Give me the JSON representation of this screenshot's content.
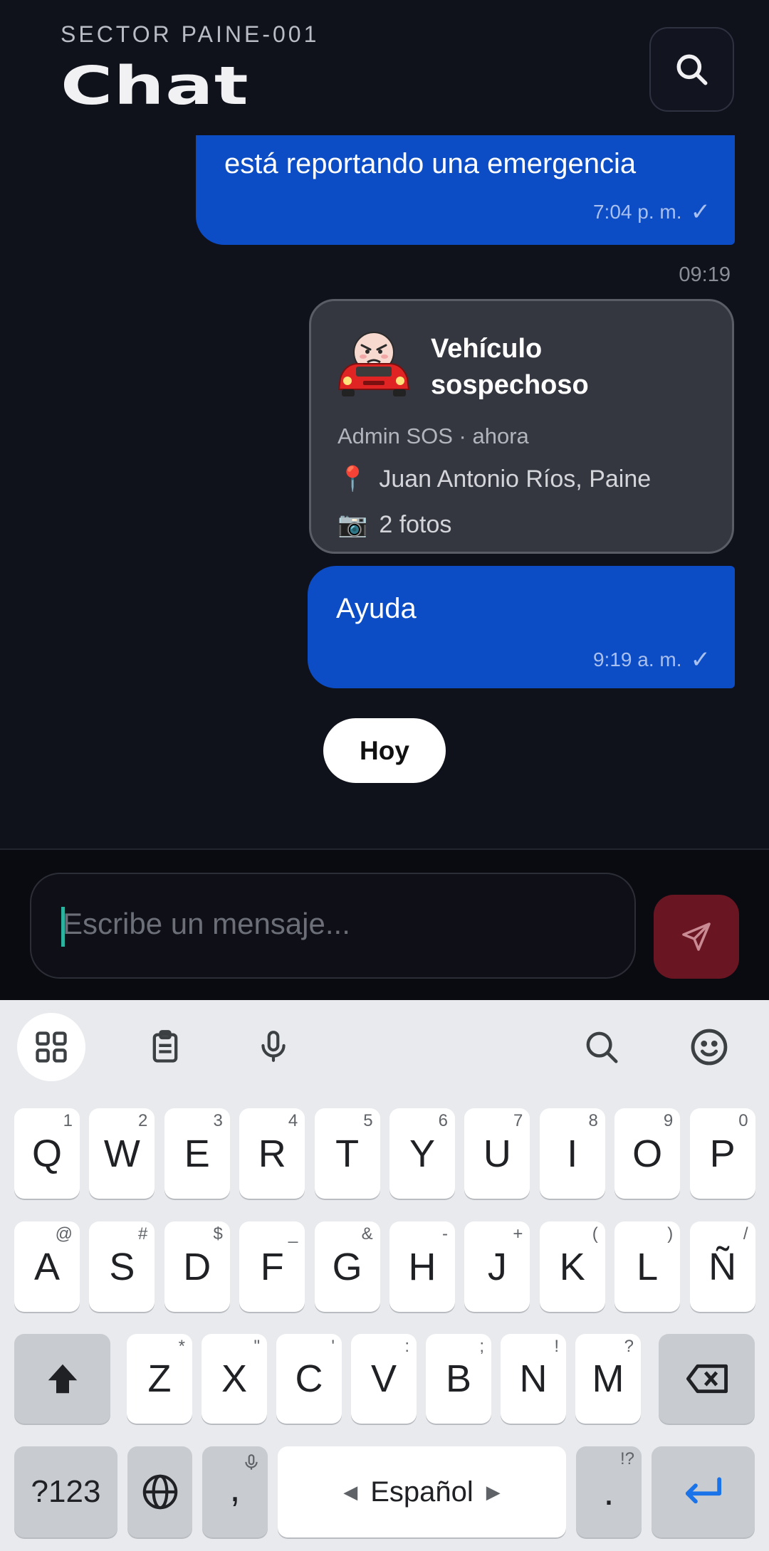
{
  "header": {
    "sector": "SECTOR PAINE-001",
    "title": "Chat"
  },
  "messages": {
    "m1": {
      "text": "está reportando una emergencia",
      "time": "7:04 p. m.",
      "check": "✓"
    },
    "separator_time": "09:19",
    "card": {
      "title": "Vehículo sospechoso",
      "subtitle": "Admin SOS · ahora",
      "location_icon": "📍",
      "location": "Juan Antonio Ríos, Paine",
      "photos_icon": "📷",
      "photos": "2 fotos"
    },
    "m2": {
      "text": "Ayuda",
      "time": "9:19 a. m.",
      "check": "✓"
    },
    "day_chip": "Hoy"
  },
  "composer": {
    "placeholder": "Escribe un mensaje..."
  },
  "keyboard": {
    "row1": [
      [
        "Q",
        "1"
      ],
      [
        "W",
        "2"
      ],
      [
        "E",
        "3"
      ],
      [
        "R",
        "4"
      ],
      [
        "T",
        "5"
      ],
      [
        "Y",
        "6"
      ],
      [
        "U",
        "7"
      ],
      [
        "I",
        "8"
      ],
      [
        "O",
        "9"
      ],
      [
        "P",
        "0"
      ]
    ],
    "row2": [
      [
        "A",
        "@"
      ],
      [
        "S",
        "#"
      ],
      [
        "D",
        "$"
      ],
      [
        "F",
        "_"
      ],
      [
        "G",
        "&"
      ],
      [
        "H",
        "-"
      ],
      [
        "J",
        "+"
      ],
      [
        "K",
        "("
      ],
      [
        "L",
        ")"
      ],
      [
        "Ñ",
        "/"
      ]
    ],
    "row3": [
      [
        "Z",
        "*"
      ],
      [
        "X",
        "\""
      ],
      [
        "C",
        "'"
      ],
      [
        "V",
        ":"
      ],
      [
        "B",
        ";"
      ],
      [
        "N",
        "!"
      ],
      [
        "M",
        "?"
      ]
    ],
    "symbols_label": "?123",
    "comma": ",",
    "space_label": "Español",
    "period": ".",
    "period_hint": "!?"
  },
  "colors": {
    "outgoing_bubble": "#0c4cc4",
    "send_button": "#6a1522",
    "card_bg": "#353740"
  }
}
